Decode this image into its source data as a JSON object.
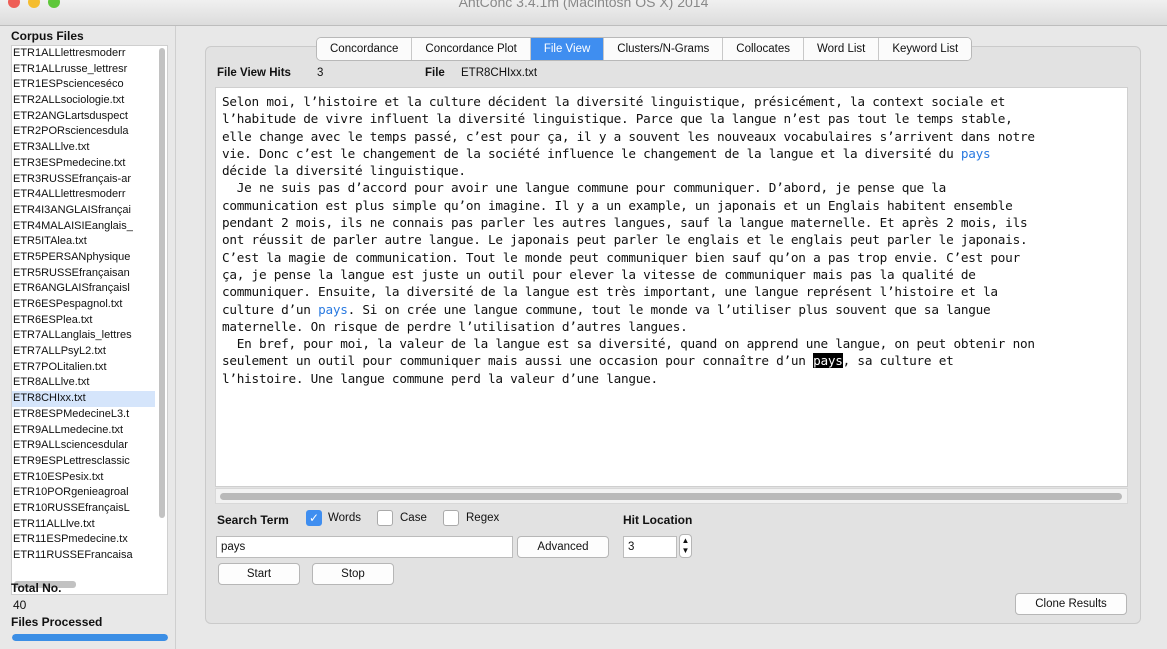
{
  "window": {
    "title": "AntConc 3.4.1m (Macintosh OS X) 2014",
    "traffic_colors": [
      "#ee5e56",
      "#f5bd2f",
      "#5ec73a"
    ]
  },
  "sidebar": {
    "corpus_header": "Corpus Files",
    "files": [
      "ETR1ALLlettresmoderr",
      "ETR1ALLrusse_lettresr",
      "ETR1ESPscienceséco",
      "ETR2ALLsociologie.txt",
      "ETR2ANGLartsduspect",
      "ETR2PORsciencesdula",
      "ETR3ALLlve.txt",
      "ETR3ESPmedecine.txt",
      "ETR3RUSSEfrançais-ar",
      "ETR4ALLlettresmoderr",
      "ETR4I3ANGLAISfrançai",
      "ETR4MALAISIEanglais_",
      "ETR5ITAlea.txt",
      "ETR5PERSANphysique",
      "ETR5RUSSEfrançaisan",
      "ETR6ANGLAISfrançaisl",
      "ETR6ESPespagnol.txt",
      "ETR6ESPlea.txt",
      "ETR7ALLanglais_lettres",
      "ETR7ALLPsyL2.txt",
      "ETR7POLitalien.txt",
      "ETR8ALLlve.txt",
      "ETR8CHIxx.txt",
      "ETR8ESPMedecineL3.t",
      "ETR9ALLmedecine.txt",
      "ETR9ALLsciencesdular",
      "ETR9ESPLettresclassic",
      "ETR10ESPesix.txt",
      "ETR10PORgenieagroal",
      "ETR10RUSSEfrançaisL",
      "ETR11ALLlve.txt",
      "ETR11ESPmedecine.tx",
      "ETR11RUSSEFrancaisa"
    ],
    "selected_index": 22,
    "total_label": "Total No.",
    "total_value": "40",
    "processed_label": "Files Processed",
    "processed_fraction": 1.0
  },
  "tabs": [
    "Concordance",
    "Concordance Plot",
    "File View",
    "Clusters/N-Grams",
    "Collocates",
    "Word List",
    "Keyword List"
  ],
  "active_tab": 2,
  "fileview": {
    "hits_label": "File View Hits",
    "hits_value": "3",
    "file_label": "File",
    "file_value": "ETR8CHIxx.txt",
    "text": {
      "l1": "Selon moi, l’histoire et la culture décident la diversité linguistique, présicément, la context sociale et",
      "l2": "l’habitude de vivre influent la diversité linguistique. Parce que la langue n’est pas tout le temps stable,",
      "l3": "elle change avec le temps passé, c’est pour ça, il y a souvent les nouveaux vocabulaires s’arrivent dans notre",
      "l4a": "vie. Donc c’est le changement de la société influence le changement de la langue et la diversité du ",
      "hit1": "pays",
      "l5": "décide la diversité linguistique.",
      "l6": "  Je ne suis pas d’accord pour avoir une langue commune pour communiquer. D’abord, je pense que la",
      "l7": "communication est plus simple qu’on imagine. Il y a un example, un japonais et un Englais habitent ensemble",
      "l8": "pendant 2 mois, ils ne connais pas parler les autres langues, sauf la langue maternelle. Et après 2 mois, ils",
      "l9": "ont réussit de parler autre langue. Le japonais peut parler le englais et le englais peut parler le japonais.",
      "l10": "C’est la magie de communication. Tout le monde peut communiquer bien sauf qu’on a pas trop envie. C’est pour",
      "l11": "ça, je pense la langue est juste un outil pour elever la vitesse de communiquer mais pas la qualité de",
      "l12": "communiquer. Ensuite, la diversité de la langue est très important, une langue représent l’histoire et la",
      "l13a": "culture d’un ",
      "hit2": "pays",
      "l13b": ". Si on crée une langue commune, tout le monde va l’utiliser plus souvent que sa langue",
      "l14": "maternelle. On risque de perdre l’utilisation d’autres langues.",
      "l15": "  En bref, pour moi, la valeur de la langue est sa diversité, quand on apprend une langue, on peut obtenir non",
      "l16a": "seulement un outil pour communiquer mais aussi une occasion pour connaître d’un ",
      "hit3": "pays",
      "l16b": ", sa culture et",
      "l17": "l’histoire. Une langue commune perd la valeur d’une langue."
    }
  },
  "search": {
    "term_label": "Search Term",
    "words_label": "Words",
    "words_checked": true,
    "case_label": "Case",
    "case_checked": false,
    "regex_label": "Regex",
    "regex_checked": false,
    "value": "pays",
    "advanced_label": "Advanced",
    "start_label": "Start",
    "stop_label": "Stop",
    "hit_location_label": "Hit Location",
    "hit_location_value": "3",
    "clone_label": "Clone Results"
  }
}
